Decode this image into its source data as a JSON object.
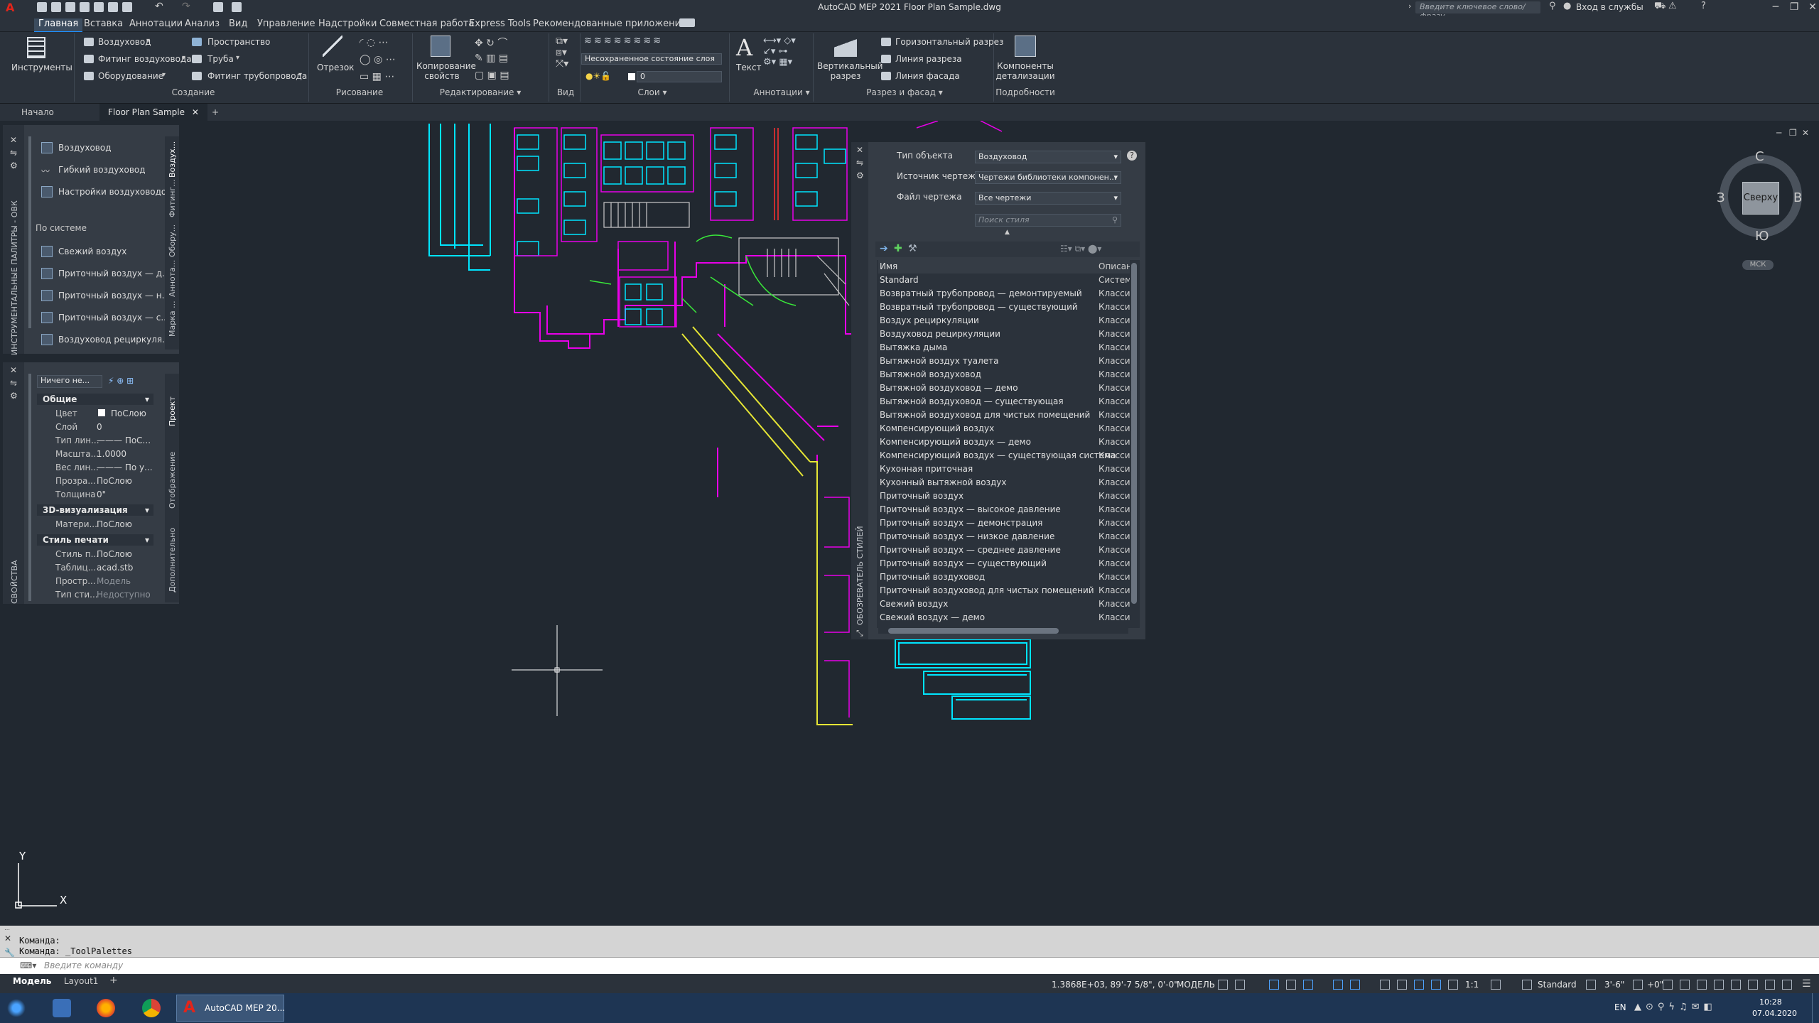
{
  "app": {
    "title": "AutoCAD MEP 2021   Floor Plan Sample.dwg",
    "search_placeholder": "Введите ключевое слово/фразу",
    "signin": "Вход в службы"
  },
  "menu": [
    "Главная",
    "Вставка",
    "Аннотации",
    "Анализ",
    "Вид",
    "Управление",
    "Надстройки",
    "Совместная работа",
    "Express Tools",
    "Рекомендованные приложения"
  ],
  "ribbon": {
    "tools_label": "Инструменты",
    "create": {
      "items": [
        "Воздуховод",
        "Фитинг воздуховода",
        "Оборудование",
        "Пространство",
        "Труба",
        "Фитинг трубопровода"
      ],
      "group": "Создание"
    },
    "draw": {
      "segment": "Отрезок",
      "group": "Рисование"
    },
    "edit": {
      "copy_props": "Копирование свойств",
      "group": "Редактирование"
    },
    "view": {
      "group": "Вид"
    },
    "layers": {
      "state": "Несохраненное состояние слоя",
      "layer": "0",
      "group": "Слои"
    },
    "annot": {
      "text": "Текст",
      "group": "Аннотации"
    },
    "section": {
      "vertical": "Вертикальный разрез",
      "horizontal": "Горизонтальный разрез",
      "section_line": "Линия разреза",
      "elevation_line": "Линия фасада",
      "group": "Разрез и фасад"
    },
    "details": {
      "components": "Компоненты детализации",
      "group": "Подробности"
    }
  },
  "tabs": {
    "start": "Начало",
    "doc": "Floor Plan Sample"
  },
  "tool_palette": {
    "items": [
      "Воздуховод",
      "Гибкий воздуховод",
      "Настройки воздуховодов"
    ],
    "section": "По системе",
    "system_items": [
      "Свежий воздух",
      "Приточный воздух — д...",
      "Приточный воздух — н...",
      "Приточный воздух — с...",
      "Воздуховод рециркуля..."
    ],
    "vtabs": [
      "Воздух...",
      "Фитинг...",
      "Обору...",
      "Аннота...",
      "Марка ..."
    ],
    "side_title": "ИНСТРУМЕНТАЛЬНЫЕ ПАЛИТРЫ - ОВК"
  },
  "properties": {
    "selector": "Ничего не...",
    "general": "Общие",
    "rows": [
      [
        "Цвет",
        "ПоСлою"
      ],
      [
        "Слой",
        "0"
      ],
      [
        "Тип лин...",
        "——— ПоС..."
      ],
      [
        "Масшта...",
        "1.0000"
      ],
      [
        "Вес лин...",
        "——— По у..."
      ],
      [
        "Прозра...",
        "ПоСлою"
      ],
      [
        "Толщина",
        "0\""
      ]
    ],
    "viz": "3D-визуализация",
    "viz_rows": [
      [
        "Матери...",
        "ПоСлою"
      ]
    ],
    "plot": "Стиль печати",
    "plot_rows": [
      [
        "Стиль п...",
        "ПоСлою"
      ],
      [
        "Таблиц...",
        "acad.stb"
      ],
      [
        "Простр...",
        "Модель"
      ],
      [
        "Тип сти...",
        "Недоступно"
      ]
    ],
    "vtabs": [
      "Проект",
      "Отображение",
      "Дополнительно"
    ],
    "side_title": "СВОЙСТВА"
  },
  "style_browser": {
    "object_type_label": "Тип объекта",
    "object_type": "Воздуховод",
    "source_label": "Источник чертежа",
    "source": "Чертежи библиотеки компонен...",
    "file_label": "Файл чертежа",
    "file": "Все чертежи",
    "search_placeholder": "Поиск стиля",
    "col_name": "Имя",
    "col_desc": "Описан",
    "rows": [
      [
        "Standard",
        "Систем"
      ],
      [
        "Возвратный трубопровод — демонтируемый",
        "Классиф"
      ],
      [
        "Возвратный трубопровод — существующий",
        "Классиф"
      ],
      [
        "Воздух рециркуляции",
        "Классиф"
      ],
      [
        "Воздуховод рециркуляции",
        "Классиф"
      ],
      [
        "Вытяжка дыма",
        "Классиф"
      ],
      [
        "Вытяжной воздух туалета",
        "Классиф"
      ],
      [
        "Вытяжной воздуховод",
        "Классиф"
      ],
      [
        "Вытяжной воздуховод — демо",
        "Классиф"
      ],
      [
        "Вытяжной воздуховод — существующая",
        "Классиф"
      ],
      [
        "Вытяжной воздуховод для чистых помещений",
        "Классиф"
      ],
      [
        "Компенсирующий воздух",
        "Классиф"
      ],
      [
        "Компенсирующий воздух — демо",
        "Классиф"
      ],
      [
        "Компенсирующий воздух — существующая система",
        "Классиф"
      ],
      [
        "Кухонная приточная",
        "Классиф"
      ],
      [
        "Кухонный вытяжной воздух",
        "Классиф"
      ],
      [
        "Приточный воздух",
        "Классиф"
      ],
      [
        "Приточный воздух — высокое давление",
        "Классиф"
      ],
      [
        "Приточный воздух — демонстрация",
        "Классиф"
      ],
      [
        "Приточный воздух — низкое давление",
        "Классиф"
      ],
      [
        "Приточный воздух — среднее давление",
        "Классиф"
      ],
      [
        "Приточный воздух — существующий",
        "Классиф"
      ],
      [
        "Приточный воздуховод",
        "Классиф"
      ],
      [
        "Приточный воздуховод для чистых помещений",
        "Классиф"
      ],
      [
        "Свежий воздух",
        "Классиф"
      ],
      [
        "Свежий воздух — демо",
        "Классиф"
      ]
    ],
    "side_title": "ОБОЗРЕВАТЕЛЬ СТИЛЕЙ"
  },
  "viewcube": {
    "n": "С",
    "s": "Ю",
    "w": "З",
    "e": "В",
    "top": "Сверху",
    "wcs": "МСК"
  },
  "ucs": {
    "x": "X",
    "y": "Y"
  },
  "command": {
    "line1": "Команда:",
    "line2": "Команда: _ToolPalettes",
    "prompt": "Введите команду"
  },
  "layouts": {
    "model": "Модель",
    "layout1": "Layout1"
  },
  "status": {
    "coords": "1.3868E+03, 89'-7 5/8\", 0'-0\"",
    "model": "МОДЕЛЬ",
    "scale": "1:1",
    "style": "Standard",
    "elev": "3'-6\"",
    "elev2": "+0\""
  },
  "taskbar": {
    "app": "AutoCAD MEP 20...",
    "lang": "EN",
    "time": "10:28",
    "date": "07.04.2020"
  },
  "colors": {
    "bg": "#212830",
    "ui": "#2b323b",
    "cyan": "#00e5ff",
    "magenta": "#e800e8",
    "green": "#39e83a",
    "yellow": "#e6e635"
  }
}
